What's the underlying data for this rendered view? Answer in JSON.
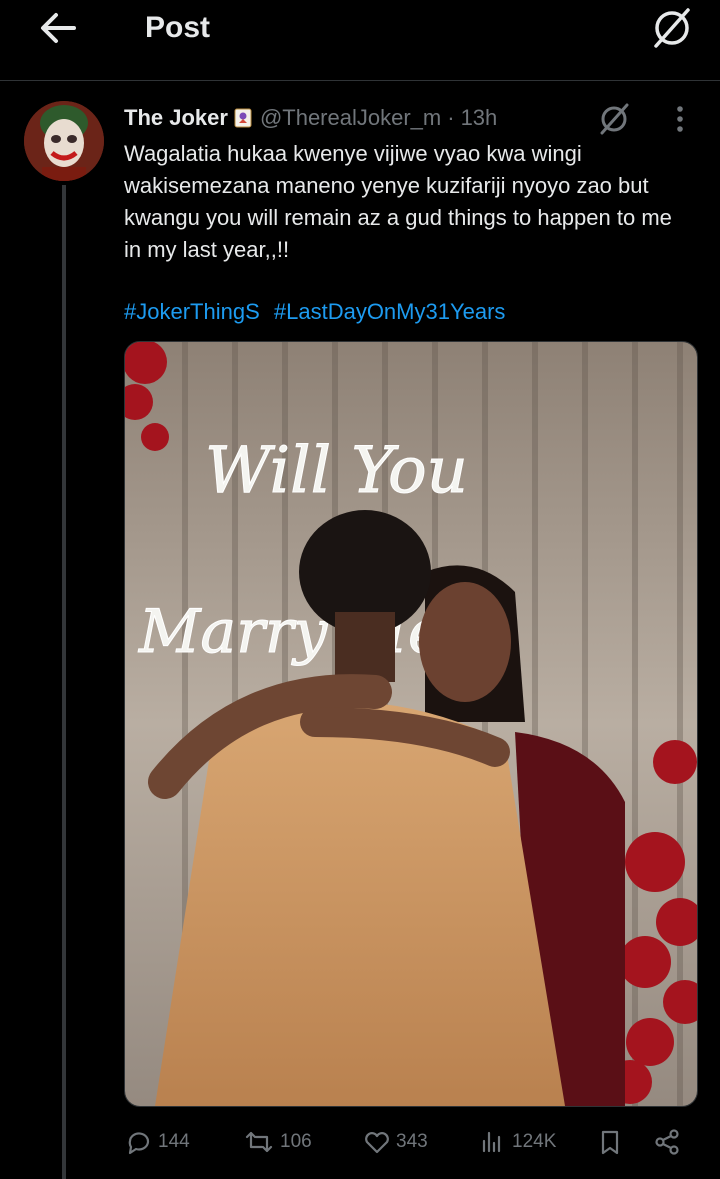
{
  "header": {
    "title": "Post"
  },
  "tweet": {
    "name": "The Joker",
    "handle": "@TherealJoker_m",
    "separator": "·",
    "time": "13h",
    "text": "Wagalatia hukaa kwenye vijiwe vyao kwa wingi wakisemezana maneno yenye kuzifariji nyoyo zao but kwangu you will remain az a gud things to happen to me in my last year,,!!",
    "hashtags": [
      "#JokerThingS",
      "#LastDayOnMy31Years"
    ],
    "image": {
      "sign_line1": "Will You",
      "sign_line2": "Marry Me?"
    }
  },
  "actions": {
    "replies": "144",
    "reposts": "106",
    "likes": "343",
    "views": "124K"
  },
  "colors": {
    "background": "#000000",
    "text": "#e7e9ea",
    "muted": "#71767b",
    "link": "#1d9bf0",
    "divider": "#2f3336"
  },
  "icons": [
    "back-arrow-icon",
    "grok-icon",
    "more-icon",
    "reply-icon",
    "repost-icon",
    "like-icon",
    "views-icon",
    "bookmark-icon",
    "share-icon"
  ]
}
